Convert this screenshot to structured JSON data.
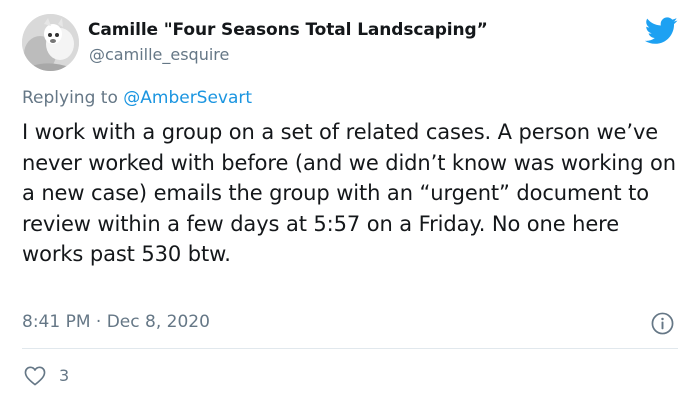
{
  "author": {
    "display_name": "Camille \"Four Seasons Total Landscaping”",
    "handle": "@camille_esquire",
    "avatar_icon": "avatar-photo"
  },
  "reply": {
    "prefix": "Replying to ",
    "mention": "@AmberSevart"
  },
  "tweet": {
    "text": "I work with a group on a set of related cases. A person we’ve never worked with before (and we didn’t know was working on a new case) emails the group with an “urgent” document to review within a few days at 5:57 on a Friday. No one here works past 530 btw.",
    "timestamp": "8:41 PM · Dec 8, 2020"
  },
  "actions": {
    "like_count": "3"
  },
  "colors": {
    "brand": "#1da1f2",
    "secondary_text": "#657786",
    "mention": "#1b95e0"
  },
  "icons": [
    "twitter-bird-icon",
    "info-icon",
    "heart-icon"
  ]
}
